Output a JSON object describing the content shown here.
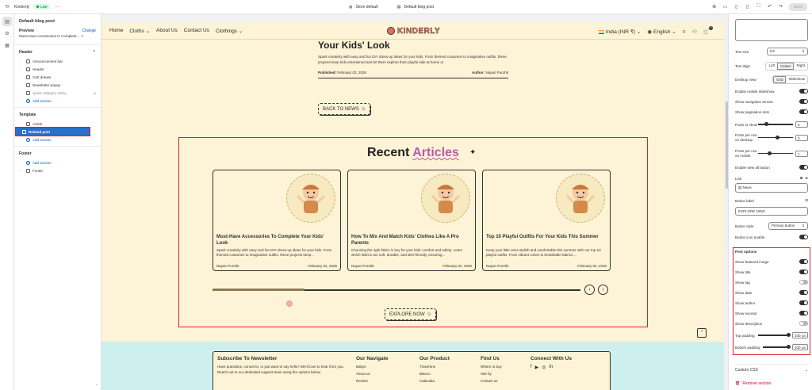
{
  "topbar": {
    "store_name": "Kindenly",
    "live_label": "Live",
    "more": "···",
    "store_default": "Store default",
    "template": "Default blog post",
    "save_label": "Save"
  },
  "left": {
    "title": "Default blog post",
    "preview_label": "Preview",
    "change_label": "Change",
    "preview_value": "Must-Have Accessories to Complete...",
    "header_section": "Header",
    "header_items": [
      "Announcement bar",
      "Header",
      "Cart drawer",
      "Newsletter popup",
      "Quick category sticky"
    ],
    "add_section": "Add section",
    "template_section": "Template",
    "template_items": [
      "Article",
      "Related post"
    ],
    "footer_section": "Footer",
    "footer_items": [
      "Footer"
    ]
  },
  "site": {
    "nav": [
      "Home",
      "Cloths ⌄",
      "About Us",
      "Contact Us",
      "Clothings ⌄"
    ],
    "logo": "KINDERLY",
    "country": "India (INR ₹) ⌄",
    "language": "English ⌄",
    "cart_count": "0",
    "article_title": "Your Kids' Look",
    "article_text": "Spark creativity with easy and fun DIY dress-up ideas for your kids. From themed costumes to imaginative outfits, these projects keep kids entertained and let them explore their playful side at home or",
    "published_label": "Published:",
    "published_date": "February 02, 2026",
    "author_label": "Author:",
    "author_name": "Nayan Purohit",
    "back_btn": "BACK TO NEWS",
    "recent_title": "Recent",
    "recent_accent": "Articles",
    "cards": [
      {
        "title": "Must-Have Accessories To Complete Your Kids' Look",
        "excerpt": "Spark creativity with easy and fun DIY dress-up ideas for your kids. From themed costumes to imaginative outfits, these projects keep...",
        "author": "Nayan Purohit",
        "date": "February 02, 2026"
      },
      {
        "title": "How To Mix And Match Kids' Clothes Like A Pro Parents",
        "excerpt": "Choosing the right fabric is key for your kids' comfort and safety. Learn which fabrics are soft, durable, and skin-friendly, ensuring...",
        "author": "Nayan Purohit",
        "date": "February 02, 2026"
      },
      {
        "title": "Top 10 Playful Outfits For Your Kids This Summer",
        "excerpt": "Keep your little ones stylish and comfortable this summer with our top 10 playful outfits. From vibrant colors to breathable fabrics,...",
        "author": "Nayan Purohit",
        "date": "February 02, 2026"
      }
    ],
    "slider_progress": 0.25,
    "page_dot": "1",
    "explore_btn": "EXPLORE NOW",
    "footer": {
      "subscribe_title": "Subscribe To Newsletter",
      "subscribe_text": "Have questions, concerns, or just want to say hello? We'd love to hear from you. Reach out to our dedicated support team using the options below.",
      "nav_title": "Our Navigate",
      "nav_links": [
        "Babys",
        "About us",
        "Review"
      ],
      "product_title": "Our Product",
      "product_links": [
        "Travertine",
        "Blanco",
        "Calacatta"
      ],
      "find_title": "Find Us",
      "find_links": [
        "Where to buy",
        "Site by",
        "Contact us"
      ],
      "connect_title": "Connect With Us"
    }
  },
  "right": {
    "text_size_label": "Text size",
    "text_size_value": "H3",
    "text_align_label": "Text align",
    "align_options": [
      "Left",
      "Center",
      "Right"
    ],
    "desktop_view_label": "Desktop view",
    "view_options": [
      "Grid",
      "Slideshow"
    ],
    "enable_mobile_slideshow": "Enable mobile slideshow",
    "show_nav_arrows": "Show navigation arrows",
    "show_pagination": "Show pagination dots",
    "posts_to_show": "Posts to show",
    "posts_to_show_value": "5",
    "posts_per_row_desktop": "Posts per row on desktop",
    "posts_per_row_desktop_value": "3",
    "posts_per_row_mobile": "Posts per row on mobile",
    "posts_per_row_mobile_value": "1",
    "enable_view_all": "Enable view all button",
    "link_label": "Link",
    "link_value": "News",
    "button_label_label": "Button label",
    "button_label_value": "EXPLORE NOW",
    "button_style_label": "Button style",
    "button_style_value": "Primary button",
    "button_icon_enable": "Button icon enable",
    "post_options": "Post options",
    "show_featured_image": "Show featured image",
    "show_title": "Show title",
    "show_tag": "Show tag",
    "show_date": "Show date",
    "show_author": "Show author",
    "show_excerpt": "Show excerpt",
    "show_description": "Show description",
    "top_padding": "Top padding",
    "top_padding_value": "100",
    "bottom_padding": "Bottom padding",
    "bottom_padding_value": "100",
    "px": "px",
    "custom_css": "Custom CSS",
    "remove_section": "Remove section"
  }
}
